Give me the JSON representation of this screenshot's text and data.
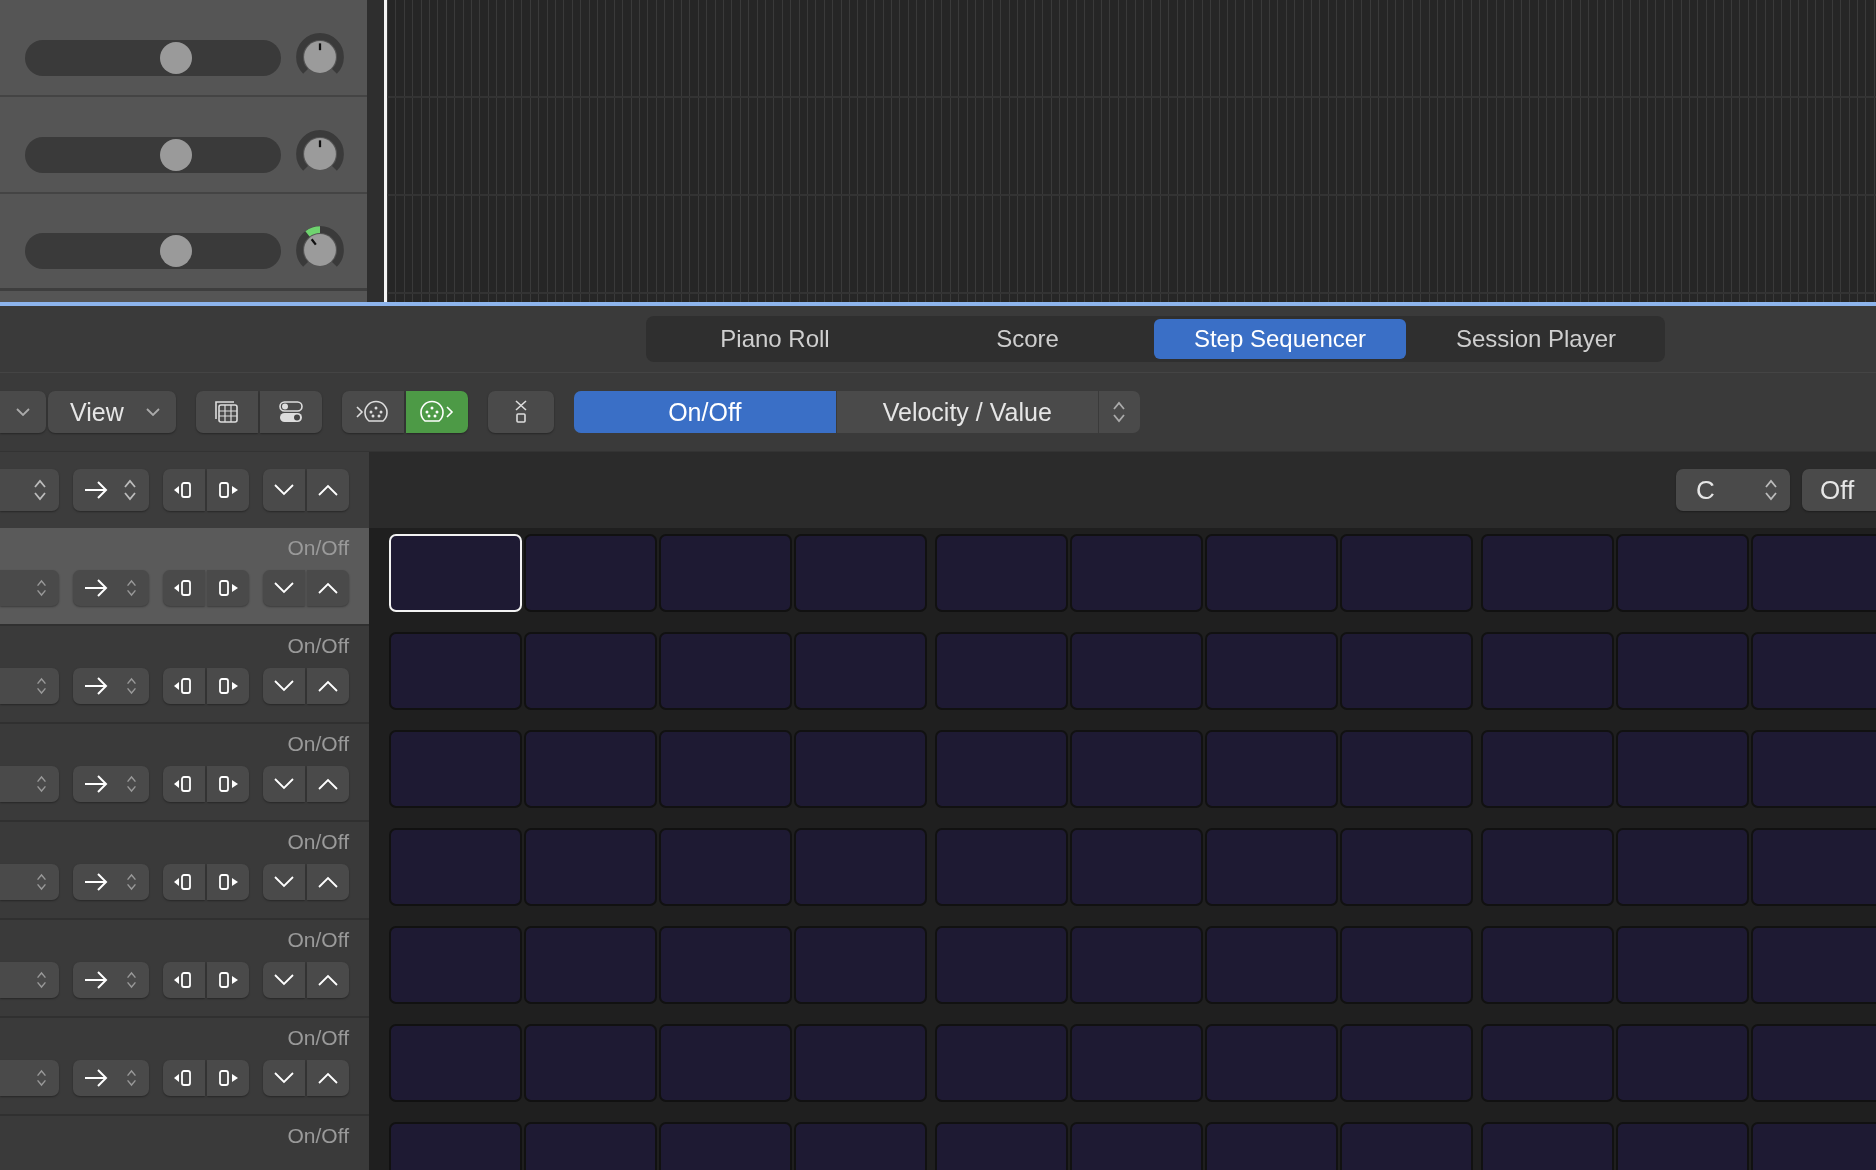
{
  "tracks": [
    {
      "volume": {
        "level": 0.62
      },
      "panned": false
    },
    {
      "volume": {
        "level": 0.62
      },
      "panned": false
    },
    {
      "volume": {
        "level": 0.62
      },
      "panned": true
    }
  ],
  "tabs": [
    {
      "label": "Piano Roll",
      "selected": false
    },
    {
      "label": "Score",
      "selected": false
    },
    {
      "label": "Step Sequencer",
      "selected": true
    },
    {
      "label": "Session Player",
      "selected": false
    }
  ],
  "toolbar": {
    "view_menu": "View",
    "midi_in": {
      "on": false
    },
    "midi_out": {
      "on": true
    },
    "mode": [
      {
        "label": "On/Off",
        "selected": true
      },
      {
        "label": "Velocity / Value",
        "selected": false
      }
    ]
  },
  "header": {
    "key": "C",
    "scale": "Off"
  },
  "rows": [
    {
      "label": "On/Off",
      "selected": true,
      "steps": [
        {
          "selected": true
        },
        {
          "selected": false
        },
        {
          "selected": false
        },
        {
          "selected": false
        },
        {
          "selected": false
        },
        {
          "selected": false
        },
        {
          "selected": false
        },
        {
          "selected": false
        },
        {
          "selected": false
        },
        {
          "selected": false
        },
        {
          "selected": false
        }
      ]
    },
    {
      "label": "On/Off",
      "selected": false,
      "steps": [
        {
          "selected": false
        },
        {
          "selected": false
        },
        {
          "selected": false
        },
        {
          "selected": false
        },
        {
          "selected": false
        },
        {
          "selected": false
        },
        {
          "selected": false
        },
        {
          "selected": false
        },
        {
          "selected": false
        },
        {
          "selected": false
        },
        {
          "selected": false
        }
      ]
    },
    {
      "label": "On/Off",
      "selected": false,
      "steps": [
        {
          "selected": false
        },
        {
          "selected": false
        },
        {
          "selected": false
        },
        {
          "selected": false
        },
        {
          "selected": false
        },
        {
          "selected": false
        },
        {
          "selected": false
        },
        {
          "selected": false
        },
        {
          "selected": false
        },
        {
          "selected": false
        },
        {
          "selected": false
        }
      ]
    },
    {
      "label": "On/Off",
      "selected": false,
      "steps": [
        {
          "selected": false
        },
        {
          "selected": false
        },
        {
          "selected": false
        },
        {
          "selected": false
        },
        {
          "selected": false
        },
        {
          "selected": false
        },
        {
          "selected": false
        },
        {
          "selected": false
        },
        {
          "selected": false
        },
        {
          "selected": false
        },
        {
          "selected": false
        }
      ]
    },
    {
      "label": "On/Off",
      "selected": false,
      "steps": [
        {
          "selected": false
        },
        {
          "selected": false
        },
        {
          "selected": false
        },
        {
          "selected": false
        },
        {
          "selected": false
        },
        {
          "selected": false
        },
        {
          "selected": false
        },
        {
          "selected": false
        },
        {
          "selected": false
        },
        {
          "selected": false
        },
        {
          "selected": false
        }
      ]
    },
    {
      "label": "On/Off",
      "selected": false,
      "steps": [
        {
          "selected": false
        },
        {
          "selected": false
        },
        {
          "selected": false
        },
        {
          "selected": false
        },
        {
          "selected": false
        },
        {
          "selected": false
        },
        {
          "selected": false
        },
        {
          "selected": false
        },
        {
          "selected": false
        },
        {
          "selected": false
        },
        {
          "selected": false
        }
      ]
    },
    {
      "label": "On/Off",
      "selected": false,
      "steps": [
        {
          "selected": false
        },
        {
          "selected": false
        },
        {
          "selected": false
        },
        {
          "selected": false
        },
        {
          "selected": false
        },
        {
          "selected": false
        },
        {
          "selected": false
        },
        {
          "selected": false
        },
        {
          "selected": false
        },
        {
          "selected": false
        },
        {
          "selected": false
        }
      ]
    }
  ]
}
